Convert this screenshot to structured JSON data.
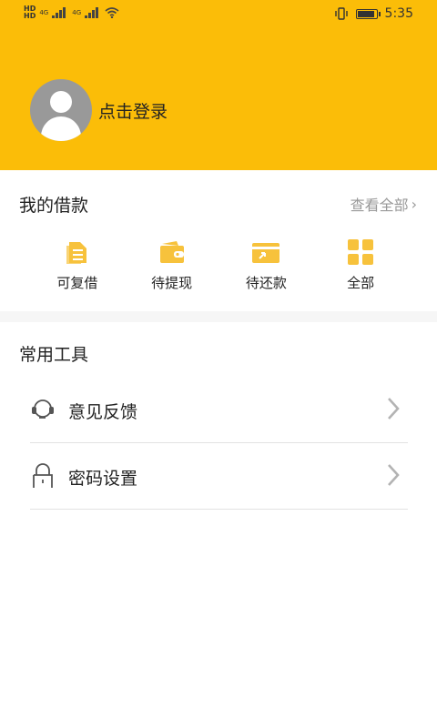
{
  "status_bar": {
    "time": "5:35",
    "network": [
      "4G",
      "4G"
    ],
    "hd_labels": [
      "HD",
      "HD"
    ],
    "battery_level": 0.85
  },
  "profile": {
    "login_label": "点击登录",
    "avatar_icon": "user-avatar-icon"
  },
  "loans": {
    "title": "我的借款",
    "view_all": "查看全部",
    "items": [
      {
        "label": "可复借",
        "icon": "document-icon"
      },
      {
        "label": "待提现",
        "icon": "wallet-icon"
      },
      {
        "label": "待还款",
        "icon": "card-repay-icon"
      },
      {
        "label": "全部",
        "icon": "grid-icon"
      }
    ]
  },
  "tools": {
    "title": "常用工具",
    "items": [
      {
        "label": "意见反馈",
        "icon": "headset-icon"
      },
      {
        "label": "密码设置",
        "icon": "lock-icon"
      }
    ]
  },
  "colors": {
    "brand": "#fbbd08",
    "icon_accent": "#f7c23c",
    "muted_text": "#999999"
  }
}
